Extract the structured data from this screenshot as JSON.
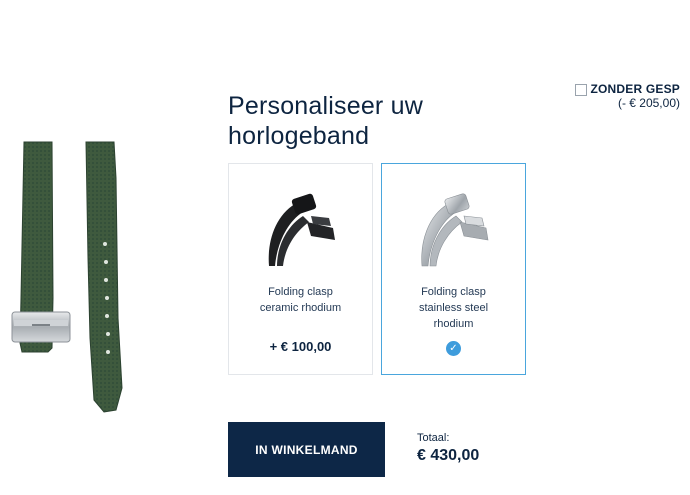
{
  "page": {
    "title": "Personaliseer uw horlogeband"
  },
  "without_buckle": {
    "label": "ZONDER GESP",
    "price": "(- € 205,00)",
    "checked": false
  },
  "strap_image": {
    "icon": "green-rubber-strap-image",
    "color": "#3f5a3e"
  },
  "options": [
    {
      "name": "Folding clasp ceramic rhodium",
      "price": "+ € 100,00",
      "icon": "black-folding-clasp-image",
      "selected": false
    },
    {
      "name": "Folding clasp stainless steel rhodium",
      "price": "",
      "icon": "steel-folding-clasp-image",
      "selected": true
    }
  ],
  "cart": {
    "button_label": "IN WINKELMAND",
    "total_label": "Totaal:",
    "total_value": "€ 430,00"
  },
  "colors": {
    "navy": "#0d2747",
    "selected_border": "#4aa6dd",
    "check": "#3e9cdc"
  }
}
